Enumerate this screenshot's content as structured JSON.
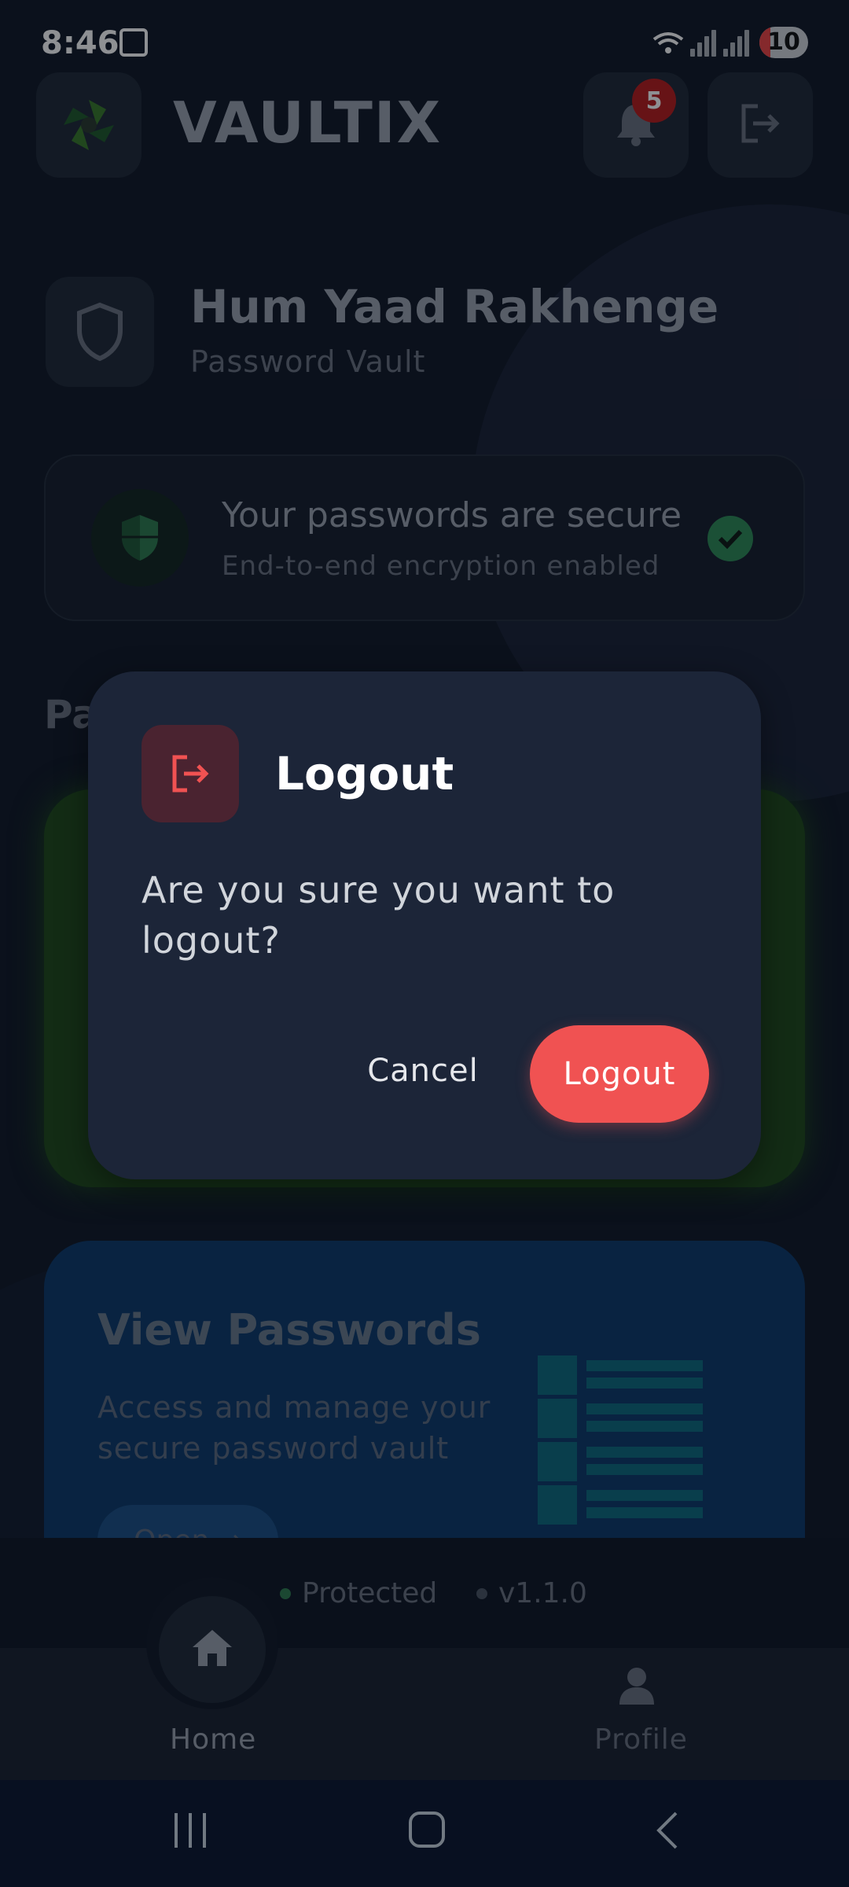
{
  "status_bar": {
    "time": "8:46",
    "battery": "10"
  },
  "header": {
    "brand": "VAULTIX",
    "notification_count": "5"
  },
  "profile": {
    "name": "Hum Yaad Rakhenge",
    "subtitle": "Password Vault"
  },
  "security": {
    "title": "Your passwords are secure",
    "subtitle": "End-to-end encryption enabled"
  },
  "section": {
    "title_partial": "Pa"
  },
  "view_passwords": {
    "title": "View Passwords",
    "description": "Access and manage your secure password vault",
    "button": "Open →"
  },
  "footer": {
    "protected": "Protected",
    "version": "v1.1.0"
  },
  "bottom_nav": {
    "home": "Home",
    "profile": "Profile"
  },
  "dialog": {
    "title": "Logout",
    "message": "Are you sure you want to logout?",
    "cancel": "Cancel",
    "confirm": "Logout"
  },
  "colors": {
    "danger": "#f05252",
    "success": "#2e8b57",
    "card_blue": "#0d3a6b",
    "card_green": "#1f4a1a"
  },
  "icons": [
    "screenshot-icon",
    "wifi-icon",
    "signal-icon",
    "battery-icon",
    "vaultix-logo-icon",
    "bell-icon",
    "logout-icon",
    "shield-icon",
    "security-shield-icon",
    "check-icon",
    "list-icon",
    "home-icon",
    "person-icon",
    "recent-apps-icon",
    "home-system-icon",
    "back-icon"
  ]
}
